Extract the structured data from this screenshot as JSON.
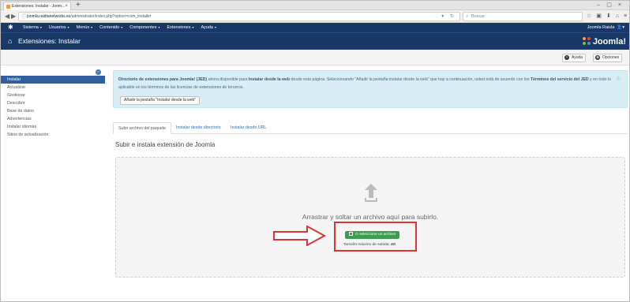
{
  "browser": {
    "tab_title": "Extensiones: Instalar - Joom...",
    "url_host": "joomla.raidtanetworks.es",
    "url_path": "/administrator/index.php?option=com_installer",
    "search_placeholder": "Buscar"
  },
  "menubar": {
    "items": [
      "Sistema",
      "Usuarios",
      "Menús",
      "Contenido",
      "Componentes",
      "Extensiones",
      "Ayuda"
    ],
    "user": "Joomla Raisla"
  },
  "header": {
    "title": "Extensiones: Instalar",
    "brand": "Joomla!"
  },
  "toolbar": {
    "help_label": "Ayuda",
    "options_label": "Opciones"
  },
  "sidebar": {
    "items": [
      {
        "label": "Instalar",
        "active": true
      },
      {
        "label": "Actualizar",
        "active": false
      },
      {
        "label": "Gestionar",
        "active": false
      },
      {
        "label": "Descubrir",
        "active": false
      },
      {
        "label": "Base de datos",
        "active": false
      },
      {
        "label": "Advertencias",
        "active": false
      },
      {
        "label": "Instalar idiomas",
        "active": false
      },
      {
        "label": "Sitios de actualización",
        "active": false
      }
    ]
  },
  "alert": {
    "bold_1": "Directorio de extensiones para Joomla! (JED)",
    "text_1": " ahora disponible para ",
    "bold_2": "Instalar desde la web",
    "text_2": " desde esta página. Seleccionando \"Añadir la pestaña instalar desde la web\" que hay a continuación, usted está de acuerdo con los ",
    "bold_3": "Términos del servicio del JED",
    "text_3": " y en todo lo aplicable en los términos de las licencias de extensiones de terceros.",
    "button_label": "Añadir la pestaña \"Instalar desde la web\""
  },
  "tabs": [
    "Subir archivo del paquete",
    "Instalar desde directorio",
    "Instalar desde URL"
  ],
  "upload": {
    "section_title": "Subir e instala extensión de Joomla",
    "drop_text": "Arrastrar y soltar un archivo aquí para subirlo.",
    "select_button": "O seleccione un archivo",
    "max_size_label": "Tamaño máximo de subida:",
    "max_size_value": "4G"
  },
  "colors": {
    "header_bg": "#1a3867",
    "active_sidebar": "#2f5f9f",
    "alert_bg": "#d9edf7",
    "select_button": "#3c9d4e",
    "annotation_red": "#d33"
  }
}
